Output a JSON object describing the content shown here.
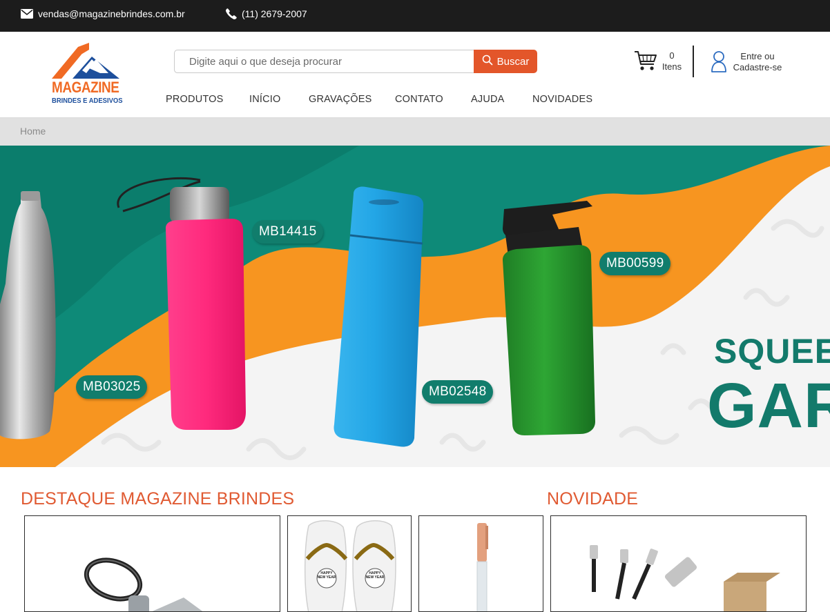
{
  "topbar": {
    "email": "vendas@magazinebrindes.com.br",
    "phone": "(11) 2679-2007"
  },
  "logo": {
    "word": "MAGAZINE",
    "sub": "BRINDES E ADESIVOS"
  },
  "search": {
    "placeholder": "Digite aqui o que deseja procurar",
    "button_label": "Buscar"
  },
  "nav": {
    "items": [
      "PRODUTOS",
      "INÍCIO",
      "GRAVAÇÕES",
      "CONTATO",
      "AJUDA",
      "NOVIDADES"
    ]
  },
  "cart": {
    "count": "0",
    "label": "Itens"
  },
  "account": {
    "line1": "Entre ou",
    "line2": "Cadastre-se"
  },
  "breadcrumb": {
    "home": "Home"
  },
  "banner": {
    "tags": [
      "MB03025",
      "MB14415",
      "MB02548",
      "MB00599"
    ],
    "headline_1": "SQUEE",
    "headline_2": "GAR"
  },
  "sections": {
    "destaque_title": "DESTAQUE MAGAZINE BRINDES",
    "novidade_title": "NOVIDADE"
  },
  "products": {
    "flipflop_print_1": "HAPPY NEW YEAR",
    "flipflop_print_2": "HAPPY NEW YEAR"
  },
  "colors": {
    "topbar_bg": "#1c1c1c",
    "accent": "#e3562a",
    "section_title": "#e05a32",
    "banner_teal": "#0e8a78",
    "banner_orange": "#f79520",
    "tag_bg": "#117d6c",
    "breadcrumb_bg": "#e1e1e1"
  }
}
